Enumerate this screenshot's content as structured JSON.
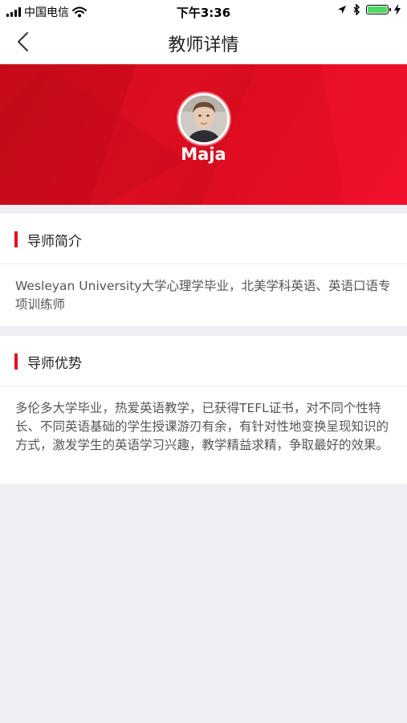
{
  "status_bar": {
    "carrier": "中国电信",
    "time": "下午3:36",
    "battery_color": "#4cd964",
    "icons": [
      "signal-icon",
      "wifi-icon",
      "location-icon",
      "bluetooth-icon",
      "battery-icon",
      "charging-icon"
    ]
  },
  "nav": {
    "title": "教师详情",
    "back_icon": "chevron-left-icon"
  },
  "profile": {
    "name": "Maja",
    "banner_color": "#e30d22"
  },
  "sections": {
    "intro": {
      "title": "导师简介",
      "body": "Wesleyan University大学心理学毕业，北美学科英语、英语口语专项训练师"
    },
    "advantages": {
      "title": "导师优势",
      "body": "多伦多大学毕业，热爱英语教学，已获得TEFL证书，对不同个性特长、不同英语基础的学生授课游刃有余，有针对性地变换呈现知识的方式，激发学生的英语学习兴趣，教学精益求精，争取最好的效果。"
    }
  },
  "accent_color": "#e3101f",
  "page_background": "#efeff4"
}
